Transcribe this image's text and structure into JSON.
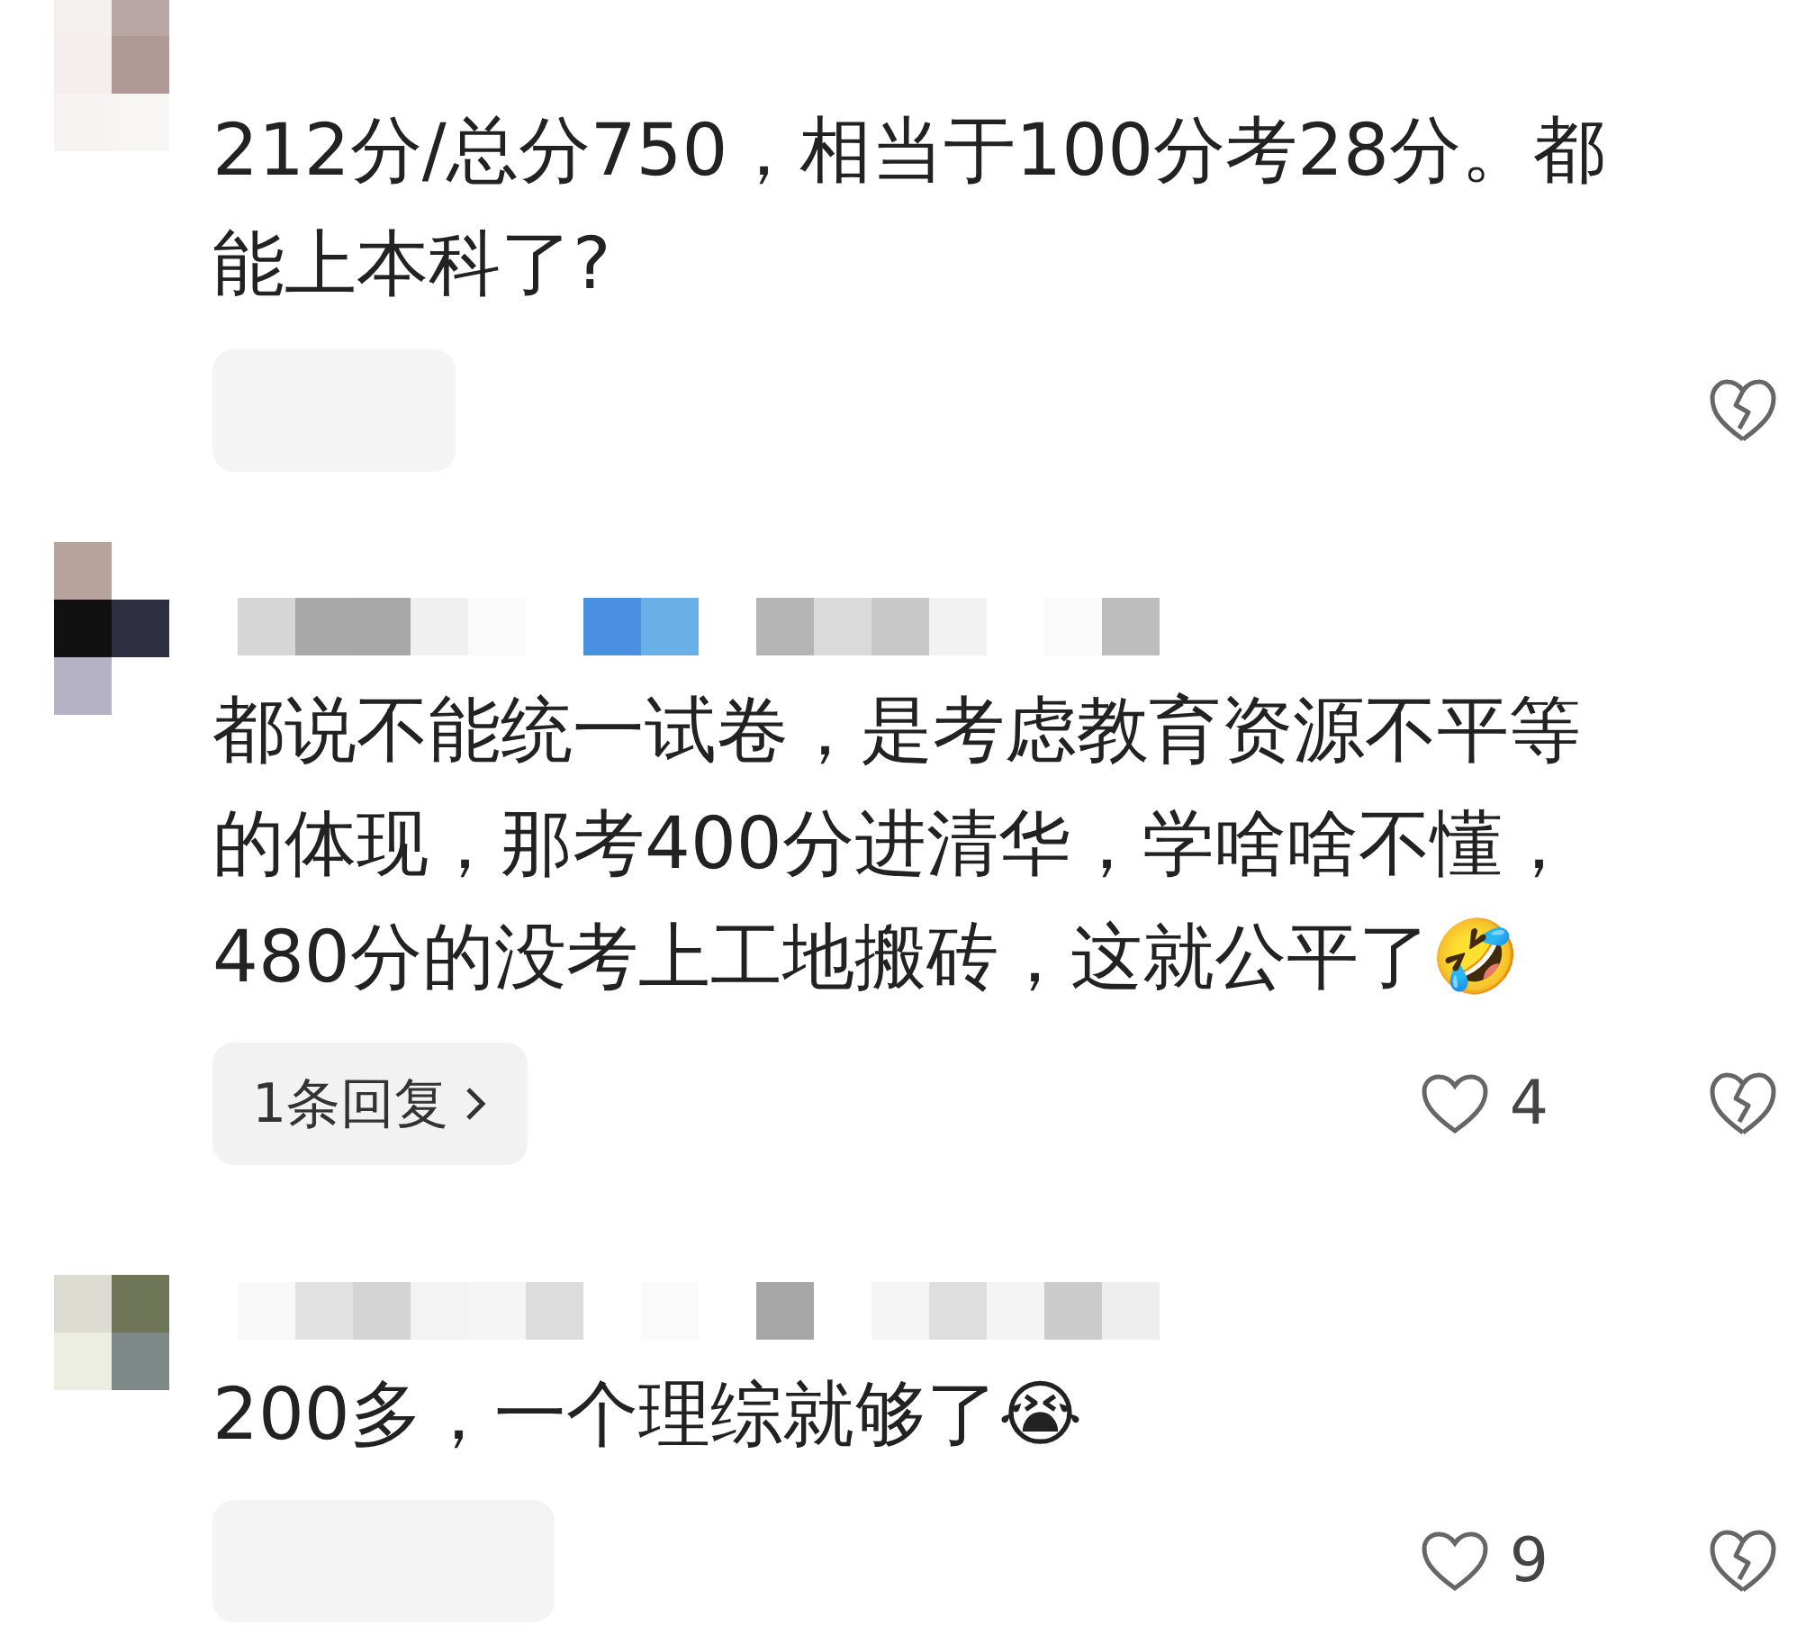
{
  "comments": [
    {
      "text": "212分/总分750，相当于100分考28分。都能上本科了?"
    },
    {
      "text": "都说不能统一试卷，是考虑教育资源不平等的体现，那考400分进清华，学啥啥不懂，480分的没考上工地搬砖，这就公平了🤣",
      "reply_label": "1条回复",
      "likes": "4"
    },
    {
      "text": "200多，一个理综就够了😭",
      "likes": "9"
    }
  ]
}
